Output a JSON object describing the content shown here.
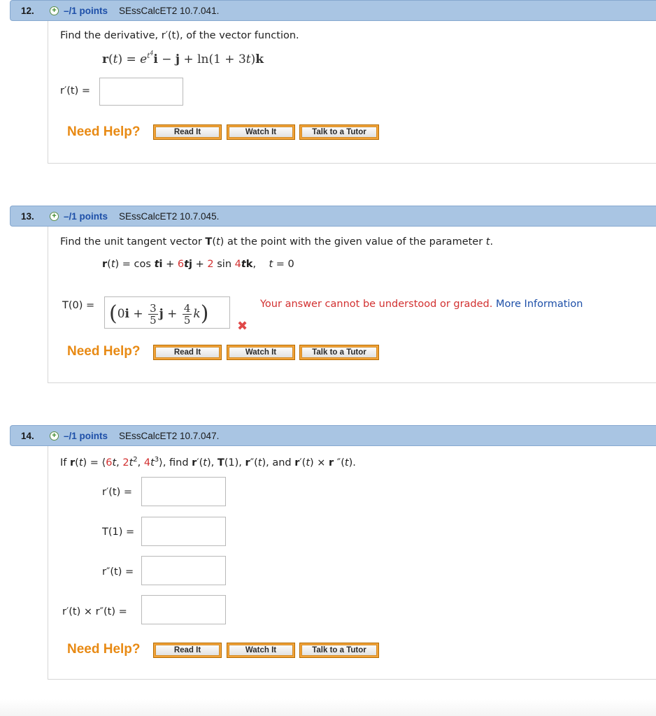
{
  "questions": [
    {
      "number": "12.",
      "points": "–/1 points",
      "ref": "SEssCalcET2 10.7.041.",
      "prompt": "Find the derivative, r′(t), of the vector function.",
      "equation": "r(t) = e^(t⁴) i − j + ln(1 + 3t) k",
      "answer_label": "r′(t) ="
    },
    {
      "number": "13.",
      "points": "–/1 points",
      "ref": "SEssCalcET2 10.7.045.",
      "prompt_pre": "Find the unit tangent vector ",
      "prompt_T": "T",
      "prompt_mid": "(",
      "prompt_t": "t",
      "prompt_post": ") at the point with the given value of the parameter ",
      "prompt_t2": "t",
      "prompt_end": ".",
      "equation": "r(t) = cos ti + 6tj + 2 sin 4tk,   t = 0",
      "answer_label": "T(0) =",
      "answer_value": "⟨0i + 3/5 j + 4/5 k⟩",
      "error_text": "Your answer cannot be understood or graded.",
      "more_info": "More Information",
      "error_icon": "x-mark-icon"
    },
    {
      "number": "14.",
      "points": "–/1 points",
      "ref": "SEssCalcET2 10.7.047.",
      "prompt": "If r(t) = ⟨6t, 2t², 4t³⟩, find r′(t), T(1), r″(t), and r′(t) × r ″(t).",
      "labels": [
        "r′(t) =",
        "T(1) =",
        "r″(t) =",
        "r′(t) × r″(t) ="
      ]
    }
  ],
  "help": {
    "need_help": "Need Help?",
    "read_it": "Read It",
    "watch_it": "Watch It",
    "talk_to_tutor": "Talk to a Tutor"
  },
  "colors": {
    "header_bg": "#a9c5e3",
    "points_blue": "#1d4fa8",
    "need_help_orange": "#e88a14",
    "error_red": "#d23030"
  }
}
